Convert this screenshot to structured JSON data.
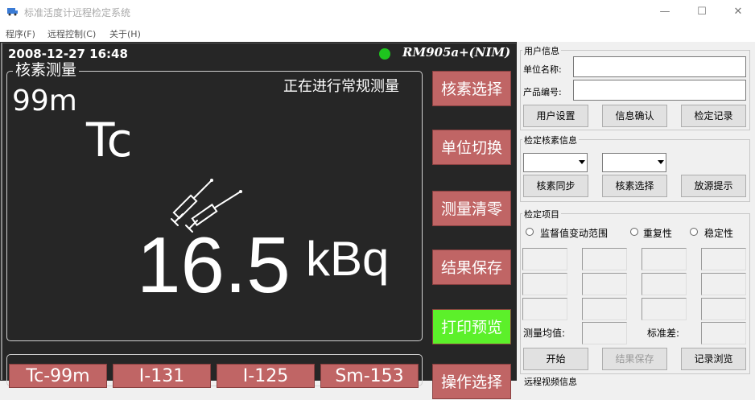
{
  "window": {
    "title": "标准活度计远程检定系统",
    "min": "—",
    "max": "☐",
    "close": "✕"
  },
  "menu": [
    {
      "label": "程序(F)"
    },
    {
      "label": "远程控制(C)"
    },
    {
      "label": "关于(H)"
    }
  ],
  "screen": {
    "datetime": "2008-12-27 16:48",
    "device": "RM905a+(NIM)",
    "panel_title": "核素测量",
    "status": "正在进行常规测量",
    "isotope_mass": "99m",
    "element": "Tc",
    "value": "16.5",
    "unit": "kBq",
    "colors": {
      "led": "#1ec41e",
      "button": "#c06565",
      "print_button": "#5cf02a"
    }
  },
  "right_buttons": [
    {
      "label": "核素选择"
    },
    {
      "label": "单位切换"
    },
    {
      "label": "测量清零"
    },
    {
      "label": "结果保存"
    },
    {
      "label": "打印预览"
    },
    {
      "label": "操作选择"
    }
  ],
  "bottom_buttons": [
    {
      "label": "Tc-99m"
    },
    {
      "label": "I-131"
    },
    {
      "label": "I-125"
    },
    {
      "label": "Sm-153"
    }
  ],
  "side": {
    "user_info": {
      "title": "用户信息",
      "unit_label": "单位名称:",
      "unit_value": "",
      "product_label": "产品编号:",
      "product_value": "",
      "buttons": [
        "用户设置",
        "信息确认",
        "检定记录"
      ]
    },
    "nuclide": {
      "title": "检定核素信息",
      "combo1": "",
      "combo2": "",
      "buttons": [
        "核素同步",
        "核素选择",
        "放源提示"
      ]
    },
    "items": {
      "title": "检定项目",
      "radios": [
        "监督值变动范围",
        "重复性",
        "稳定性"
      ],
      "mean_label": "测量均值:",
      "std_label": "标准差:",
      "buttons": [
        "开始",
        "结果保存",
        "记录浏览"
      ]
    },
    "next_group_title": "远程视频信息"
  }
}
